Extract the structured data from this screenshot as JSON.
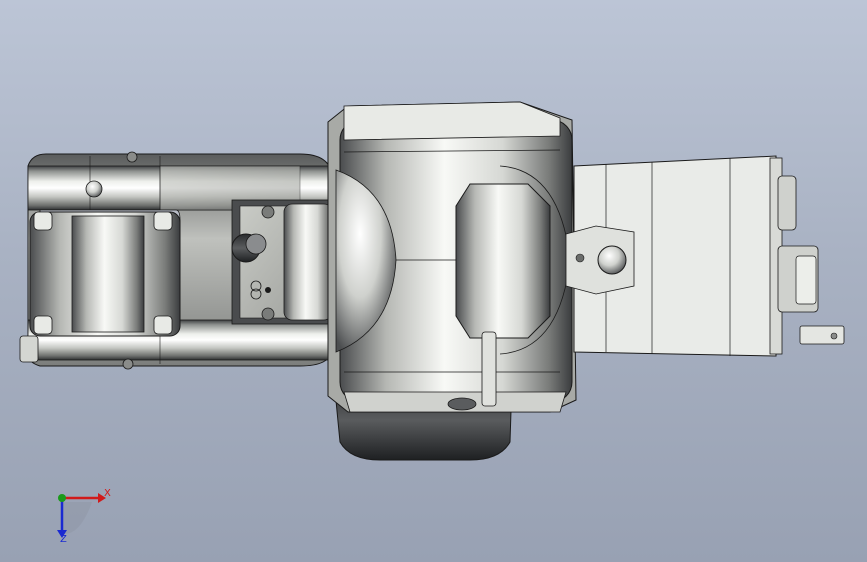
{
  "viewport": {
    "background_top": "#bcc5d6",
    "background_bottom": "#98a1b3"
  },
  "model": {
    "metal_color": "#c8cac6",
    "dark_metal_color": "#3a3c3e",
    "edge_color": "#1a1a1a"
  },
  "triad": {
    "x_label": "X",
    "y_label": "Y",
    "z_label": "Z",
    "x_color": "#d11a1a",
    "y_color": "#1a9a1a",
    "z_color": "#1a2ad1"
  }
}
